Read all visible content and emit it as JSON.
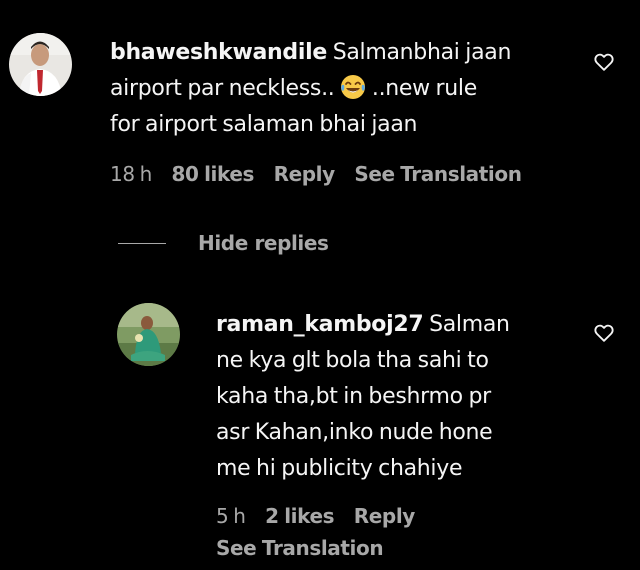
{
  "comments": [
    {
      "username": "bhaweshkwandile",
      "text_lines": [
        "Salmanbhai jaan",
        "airport par neckless..",
        "..new rule",
        "for airport salaman bhai jaan"
      ],
      "emoji": "face-with-tears-of-joy",
      "time": "18 h",
      "likes": "80 likes",
      "reply_label": "Reply",
      "translation_label": "See Translation",
      "heart_icon": "heart-outline-icon"
    },
    {
      "username": "raman_kamboj27",
      "text_lines": [
        "Salman",
        "ne kya glt bola tha sahi to",
        "kaha tha,bt in beshrmo pr",
        "asr Kahan,inko nude hone",
        "me hi publicity chahiye"
      ],
      "time": "5 h",
      "likes": "2 likes",
      "reply_label": "Reply",
      "translation_label": "See Translation",
      "heart_icon": "heart-outline-icon"
    }
  ],
  "replies_toggle": {
    "label": "Hide replies"
  },
  "colors": {
    "background": "#000000",
    "text": "#f5f5f5",
    "secondary": "#a8a8a8"
  }
}
